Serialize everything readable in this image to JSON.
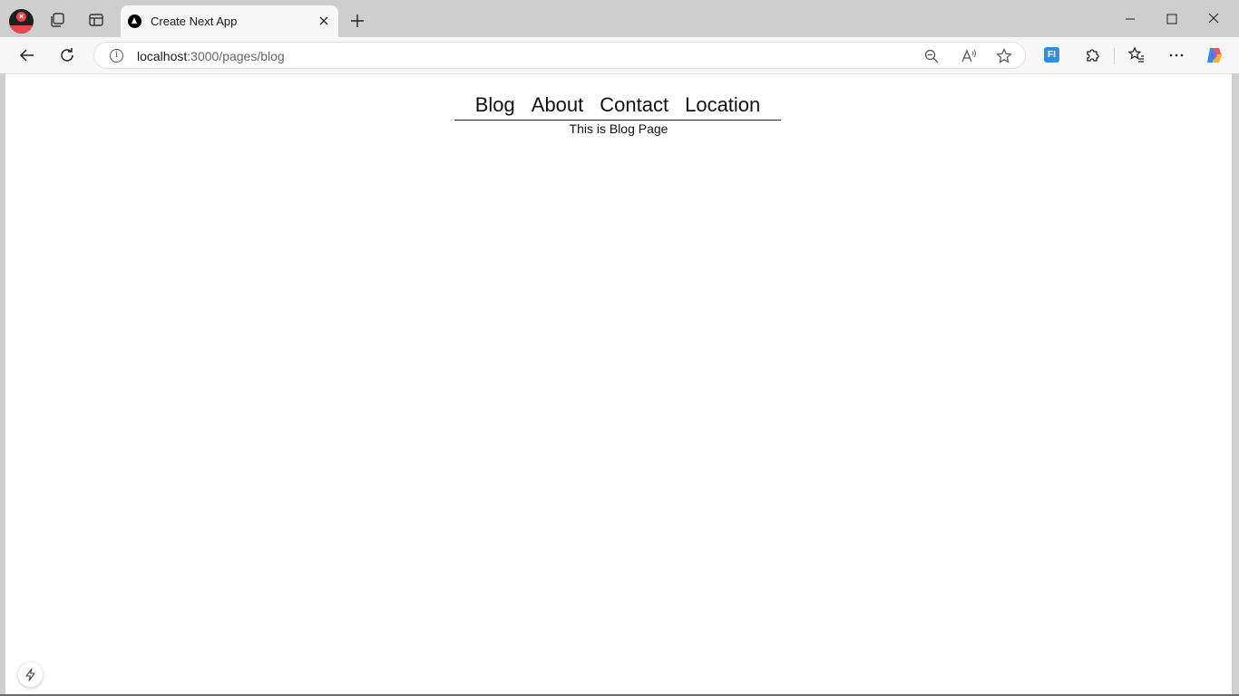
{
  "browser": {
    "tab": {
      "title": "Create Next App"
    },
    "address": {
      "host": "localhost",
      "path": ":3000/pages/blog"
    }
  },
  "site": {
    "nav": [
      "Blog",
      "About",
      "Contact",
      "Location"
    ],
    "content": "This is Blog Page"
  },
  "colors": {
    "profile_accent": "#e5484d",
    "fi_extension": "#3a8bd8"
  },
  "icons": [
    "profile-icon",
    "workspaces-icon",
    "tab-actions-icon",
    "nextjs-favicon-icon",
    "close-icon",
    "plus-icon",
    "minimize-icon",
    "maximize-icon",
    "back-arrow-icon",
    "refresh-icon",
    "info-icon",
    "zoom-out-icon",
    "read-aloud-icon",
    "favorite-star-icon",
    "extensions-icon",
    "favorites-icon",
    "more-dots-icon",
    "copilot-icon",
    "lightning-icon"
  ]
}
